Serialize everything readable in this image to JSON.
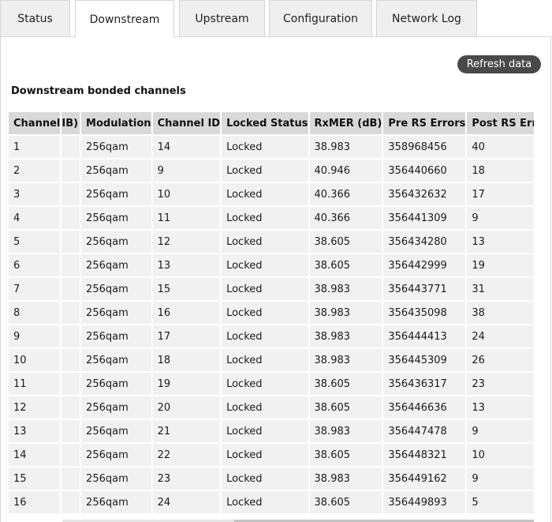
{
  "tabs": [
    {
      "label": "Status",
      "active": false
    },
    {
      "label": "Downstream",
      "active": true
    },
    {
      "label": "Upstream",
      "active": false
    },
    {
      "label": "Configuration",
      "active": false
    },
    {
      "label": "Network Log",
      "active": false
    }
  ],
  "toolbar": {
    "refresh_label": "Refresh data"
  },
  "section": {
    "title": "Downstream bonded channels"
  },
  "table": {
    "columns": [
      "Channel",
      "IB)",
      "Modulation",
      "Channel ID",
      "Locked Status",
      "RxMER (dB)",
      "Pre RS Errors",
      "Post RS Errors"
    ],
    "rows": [
      [
        "1",
        "",
        "256qam",
        "14",
        "Locked",
        "38.983",
        "358968456",
        "40"
      ],
      [
        "2",
        "",
        "256qam",
        "9",
        "Locked",
        "40.946",
        "356440660",
        "18"
      ],
      [
        "3",
        "",
        "256qam",
        "10",
        "Locked",
        "40.366",
        "356432632",
        "17"
      ],
      [
        "4",
        "",
        "256qam",
        "11",
        "Locked",
        "40.366",
        "356441309",
        "9"
      ],
      [
        "5",
        "",
        "256qam",
        "12",
        "Locked",
        "38.605",
        "356434280",
        "13"
      ],
      [
        "6",
        "",
        "256qam",
        "13",
        "Locked",
        "38.605",
        "356442999",
        "19"
      ],
      [
        "7",
        "",
        "256qam",
        "15",
        "Locked",
        "38.983",
        "356443771",
        "31"
      ],
      [
        "8",
        "",
        "256qam",
        "16",
        "Locked",
        "38.983",
        "356435098",
        "38"
      ],
      [
        "9",
        "",
        "256qam",
        "17",
        "Locked",
        "38.983",
        "356444413",
        "24"
      ],
      [
        "10",
        "",
        "256qam",
        "18",
        "Locked",
        "38.983",
        "356445309",
        "26"
      ],
      [
        "11",
        "",
        "256qam",
        "19",
        "Locked",
        "38.605",
        "356436317",
        "23"
      ],
      [
        "12",
        "",
        "256qam",
        "20",
        "Locked",
        "38.605",
        "356446636",
        "13"
      ],
      [
        "13",
        "",
        "256qam",
        "21",
        "Locked",
        "38.983",
        "356447478",
        "9"
      ],
      [
        "14",
        "",
        "256qam",
        "22",
        "Locked",
        "38.605",
        "356448321",
        "10"
      ],
      [
        "15",
        "",
        "256qam",
        "23",
        "Locked",
        "38.983",
        "356449162",
        "9"
      ],
      [
        "16",
        "",
        "256qam",
        "24",
        "Locked",
        "38.605",
        "356449893",
        "5"
      ]
    ]
  },
  "colors": {
    "tab_bg": "#efefef",
    "header_bg": "#d9d9d9",
    "row_bg": "#f1f1f1",
    "button_bg": "#4a4a4a"
  }
}
